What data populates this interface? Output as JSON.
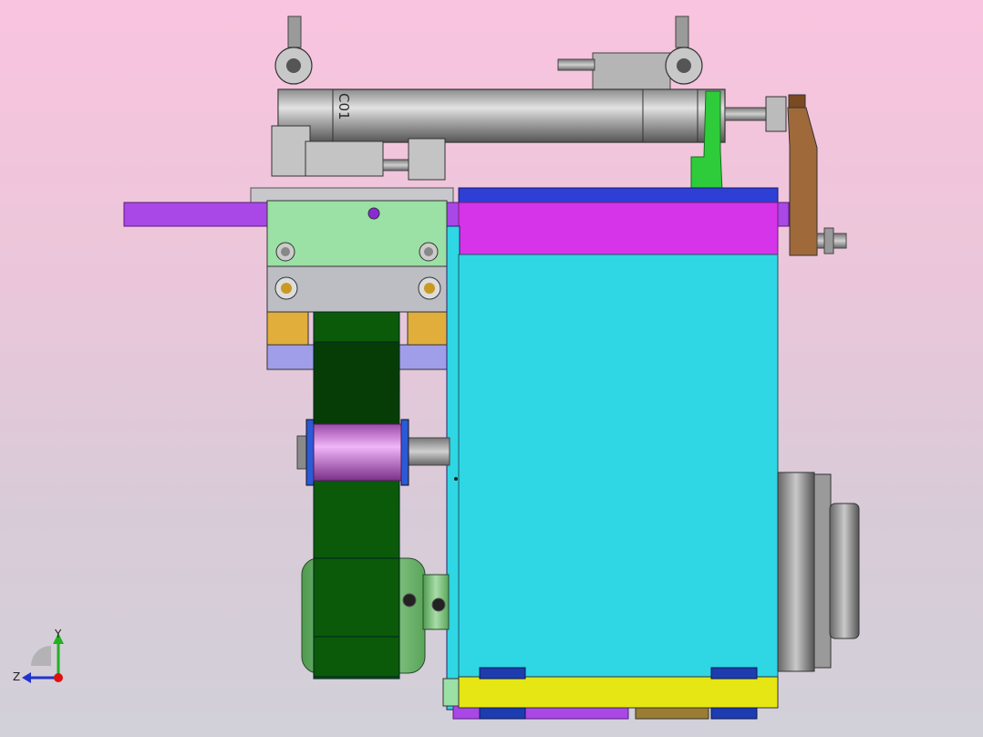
{
  "viewport": {
    "background_top": "#f9c4df",
    "background_bottom": "#d2d0d9"
  },
  "model": {
    "cylinder_label": "C01",
    "part_colors": {
      "gearbox_housing": "#2fd6e4",
      "top_plate": "#d534e8",
      "top_strip": "#2e3fd6",
      "base_plate": "#e6e614",
      "purple_bar": "#a948e6",
      "clamp_block": "#9be0a4",
      "mount_block": "#bcbec4",
      "belt": "#0a5a0a",
      "pulley": "#7ec47e",
      "roller": "#d07fe0",
      "bearing_pads": "#e1ae3c",
      "green_bracket": "#2ecc3a",
      "brown_bracket": "#a0693a",
      "motor_flange": "#8a8a8a",
      "feet": "#1d3cb0",
      "base_rail": "#9a7c32"
    }
  },
  "triad": {
    "y_label": "Y",
    "z_label": "Z",
    "y_color": "#22b022",
    "z_color": "#2233cc",
    "x_color": "#dd1111"
  }
}
